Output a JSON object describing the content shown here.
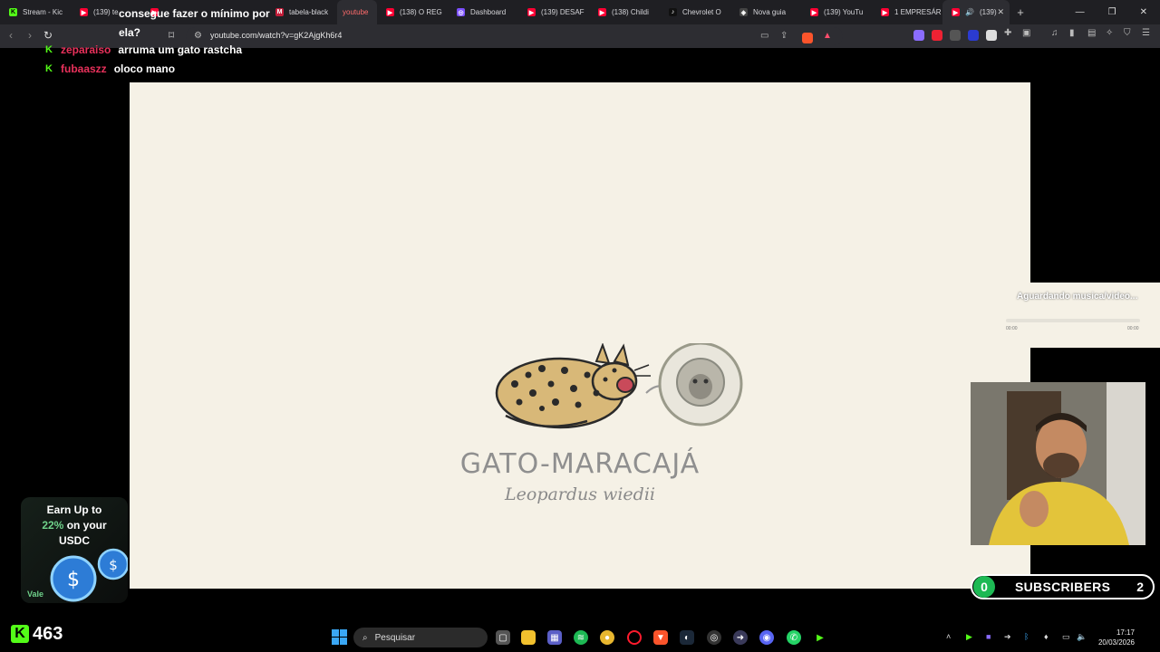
{
  "browser": {
    "tabs": [
      {
        "label": "Stream - Kic",
        "favicon": "K",
        "color": "#53fc18"
      },
      {
        "label": "(139) te",
        "favicon": "▶",
        "color": "#ff0033"
      },
      {
        "label": "",
        "favicon": "▶",
        "color": "#ff0033"
      },
      {
        "label": "",
        "favicon": "",
        "color": "#2d2d32"
      },
      {
        "label": "tabela-black",
        "favicon": "M",
        "color": "#c41e3a"
      },
      {
        "label": "youtube",
        "favicon": "",
        "color": "#2d2d32",
        "active": true
      },
      {
        "label": "(138) O REG",
        "favicon": "▶",
        "color": "#ff0033"
      },
      {
        "label": "Dashboard",
        "favicon": "◎",
        "color": "#7b4fff"
      },
      {
        "label": "(139) DESAF",
        "favicon": "▶",
        "color": "#ff0033"
      },
      {
        "label": "(138) Childi",
        "favicon": "▶",
        "color": "#ff0033"
      },
      {
        "label": "Chevrolet O",
        "favicon": "♪",
        "color": "#111111"
      },
      {
        "label": "Nova guia",
        "favicon": "◈",
        "color": "#444444"
      },
      {
        "label": "(139) YouTu",
        "favicon": "▶",
        "color": "#ff0033"
      },
      {
        "label": "1 EMPRESÁR",
        "favicon": "▶",
        "color": "#ff0033"
      },
      {
        "label": "(139)",
        "favicon": "▶",
        "color": "#ff0033",
        "current": true
      }
    ],
    "url": "youtube.com/watch?v=gK2AjgKh6r4"
  },
  "chat": [
    {
      "user": "",
      "text": "consegue fazer o mínimo por"
    },
    {
      "user": "",
      "text": "ela?"
    },
    {
      "user": "zeparaiso",
      "text": "arruma um gato rastcha"
    },
    {
      "user": "fubaaszz",
      "text": "oloco mano"
    }
  ],
  "video": {
    "title": "GATO-MARACAJÁ",
    "scientific_name": "Leopardus wiedii"
  },
  "music_widget": {
    "status": "Aguardando musica/video...",
    "time_start": "00:00",
    "time_end": "00:00"
  },
  "subscribers": {
    "left_count": "0",
    "label": "SUBSCRIBERS",
    "right_count": "2"
  },
  "ad": {
    "line1": "Earn Up to",
    "percent": "22%",
    "line2_rest": "on your",
    "line3": "USDC",
    "footer": "Vale"
  },
  "viewers": {
    "count": "463"
  },
  "taskbar": {
    "search_placeholder": "Pesquisar",
    "time": "17:17",
    "date": "20/03/2026"
  },
  "colors": {
    "kick_green": "#53fc18",
    "chat_user": "#e8315b",
    "video_bg": "#f5f1e6"
  }
}
